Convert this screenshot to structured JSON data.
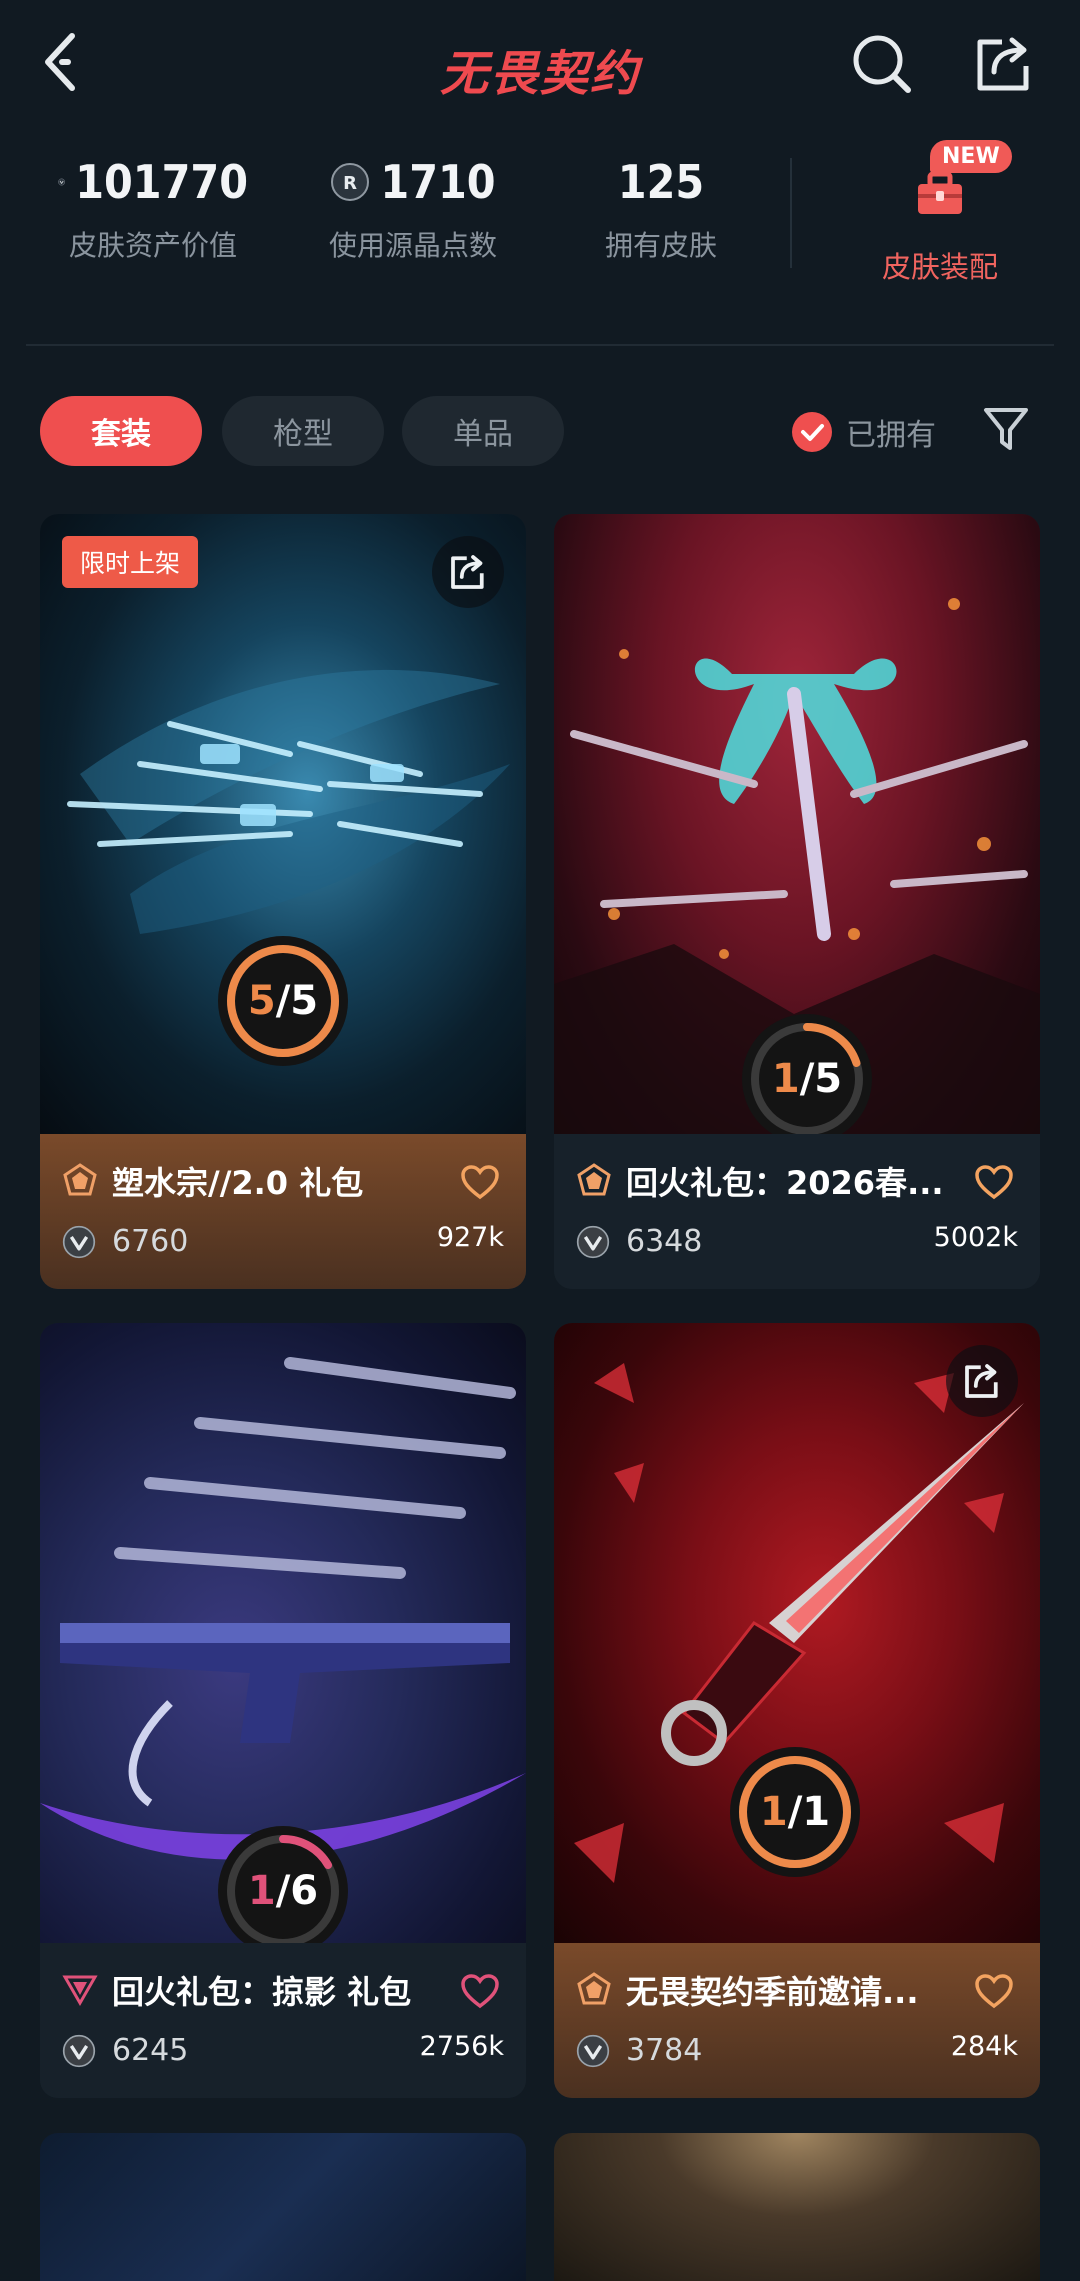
{
  "header": {
    "title": "无畏契约",
    "back_icon": "chevron-left-icon",
    "search_icon": "search-icon",
    "share_icon": "share-icon"
  },
  "stats": {
    "asset_value": {
      "value": "101770",
      "label": "皮肤资产价值",
      "icon": "vp-coin-icon"
    },
    "radianite": {
      "value": "1710",
      "label": "使用源晶点数",
      "icon": "radianite-icon"
    },
    "owned_skins": {
      "value": "125",
      "label": "拥有皮肤"
    },
    "equip": {
      "label": "皮肤装配",
      "badge": "NEW",
      "icon": "toolbox-icon"
    }
  },
  "filters": {
    "tabs": [
      {
        "label": "套装",
        "active": true
      },
      {
        "label": "枪型",
        "active": false
      },
      {
        "label": "单品",
        "active": false
      }
    ],
    "owned_label": "已拥有",
    "owned_checked": true
  },
  "colors": {
    "accent": "#ef4f4f",
    "background": "#111a22",
    "progress_orange": "#ee8a4a",
    "progress_pink": "#e0527a"
  },
  "cards": [
    {
      "name": "塑水宗//2.0 礼包",
      "price": "6760",
      "likes": "927k",
      "owned": "5",
      "total": "5",
      "progress_fraction": 1.0,
      "tag": "限时上架",
      "footer_style": "orange",
      "tier_icon": "tier-orange-pentagon-icon"
    },
    {
      "name": "回火礼包：2026春...",
      "price": "6348",
      "likes": "5002k",
      "owned": "1",
      "total": "5",
      "progress_fraction": 0.2,
      "footer_style": "dark",
      "tier_icon": "tier-orange-pentagon-icon"
    },
    {
      "name": "回火礼包：掠影 礼包",
      "price": "6245",
      "likes": "2756k",
      "owned": "1",
      "total": "6",
      "progress_fraction": 0.1667,
      "footer_style": "dark",
      "tier_icon": "tier-pink-triangle-icon"
    },
    {
      "name": "无畏契约季前邀请...",
      "price": "3784",
      "likes": "284k",
      "owned": "1",
      "total": "1",
      "progress_fraction": 1.0,
      "footer_style": "orange",
      "tier_icon": "tier-orange-pentagon-icon"
    }
  ]
}
